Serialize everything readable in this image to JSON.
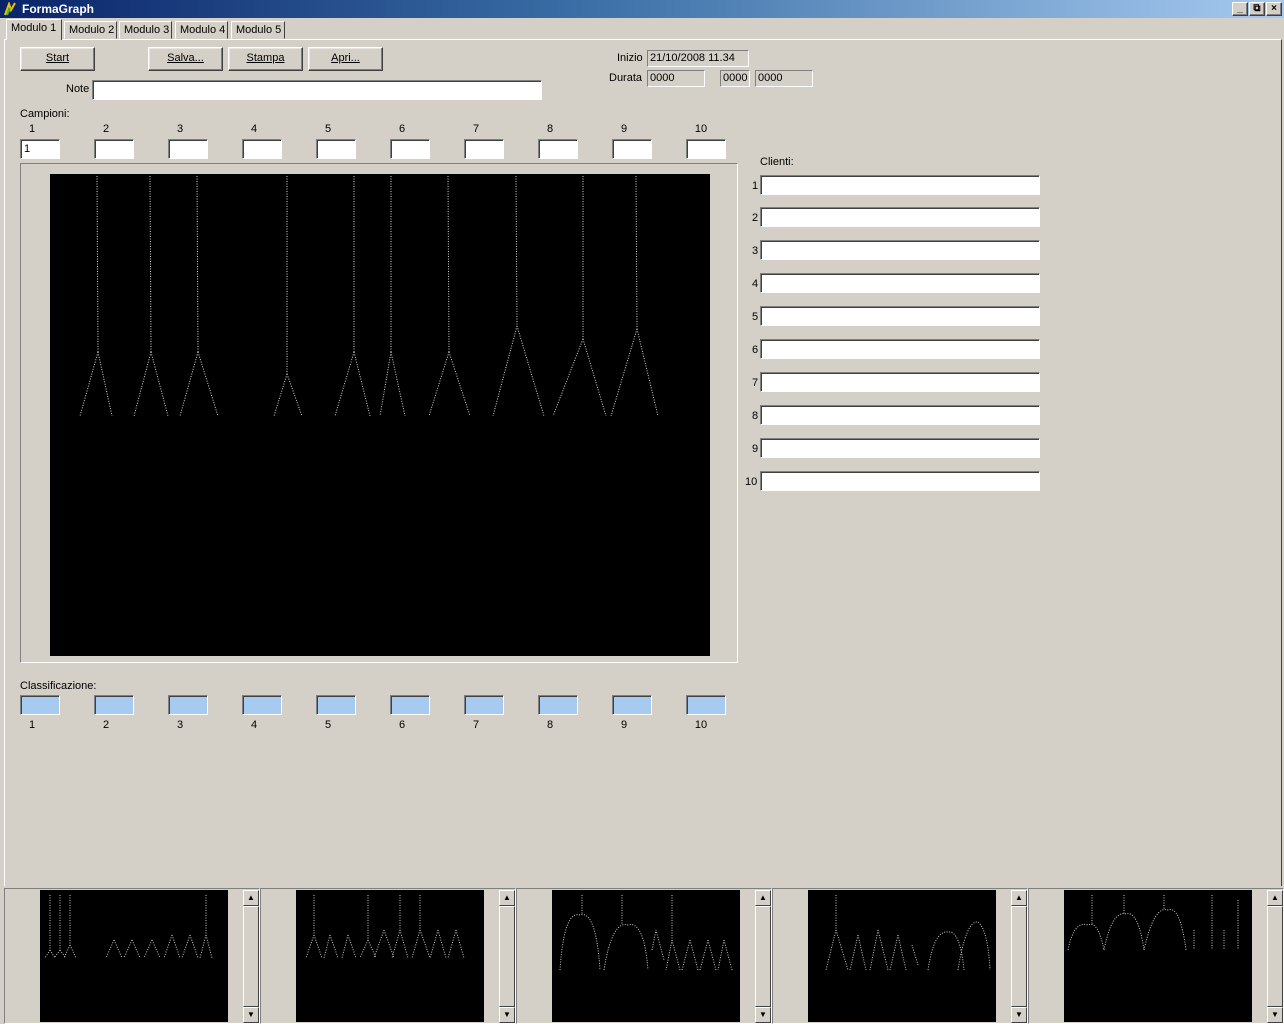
{
  "window": {
    "title": "FormaGraph"
  },
  "tabs": [
    "Modulo 1",
    "Modulo 2",
    "Modulo 3",
    "Modulo 4",
    "Modulo 5"
  ],
  "toolbar": {
    "start": "Start",
    "salva": "Salva...",
    "stampa": "Stampa",
    "apri": "Apri..."
  },
  "info": {
    "inizio_label": "Inizio",
    "inizio_value": "21/10/2008  11.34",
    "durata_label": "Durata",
    "durata_values": [
      "0000",
      "0000",
      "0000"
    ]
  },
  "note": {
    "label": "Note",
    "value": ""
  },
  "campioni": {
    "label": "Campioni:",
    "numbers": [
      "1",
      "2",
      "3",
      "4",
      "5",
      "6",
      "7",
      "8",
      "9",
      "10"
    ],
    "values": [
      "1",
      "",
      "",
      "",
      "",
      "",
      "",
      "",
      "",
      ""
    ]
  },
  "clienti": {
    "label": "Clienti:",
    "numbers": [
      "1",
      "2",
      "3",
      "4",
      "5",
      "6",
      "7",
      "8",
      "9",
      "10"
    ]
  },
  "classificazione": {
    "label": "Classificazione:",
    "numbers": [
      "1",
      "2",
      "3",
      "4",
      "5",
      "6",
      "7",
      "8",
      "9",
      "10"
    ]
  }
}
